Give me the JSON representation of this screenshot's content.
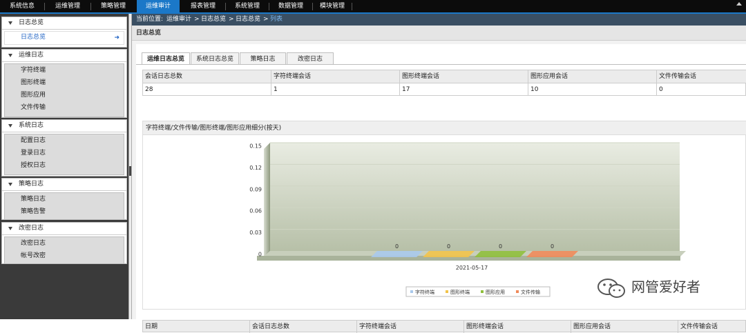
{
  "topnav": {
    "items": [
      "系统信息",
      "运维管理",
      "策略管理",
      "运维审计",
      "报表管理",
      "系统管理",
      "数据管理",
      "模块管理"
    ],
    "active_index": 3
  },
  "sidebar": {
    "groups": [
      {
        "title": "日志总览",
        "items": [
          "日志总览"
        ],
        "selected": "日志总览"
      },
      {
        "title": "运维日志",
        "items": [
          "字符终端",
          "图形终端",
          "图形应用",
          "文件传输"
        ]
      },
      {
        "title": "系统日志",
        "items": [
          "配置日志",
          "登录日志",
          "授权日志"
        ]
      },
      {
        "title": "策略日志",
        "items": [
          "策略日志",
          "策略告警"
        ]
      },
      {
        "title": "改密日志",
        "items": [
          "改密日志",
          "帐号改密"
        ]
      }
    ]
  },
  "breadcrumb": {
    "prefix": "当前位置:",
    "path": [
      "运维审计",
      "日志总览",
      "日志总览"
    ],
    "current": "列表",
    "separator": ">"
  },
  "page": {
    "title": "日志总览"
  },
  "tabs": {
    "items": [
      "运维日志总览",
      "系统日志总览",
      "策略日志",
      "改密日志"
    ],
    "active_index": 0
  },
  "summary": {
    "headers": [
      "会话日志总数",
      "字符终端会话",
      "图形终端会话",
      "图形应用会话",
      "文件传输会话"
    ],
    "values": [
      "28",
      "1",
      "17",
      "10",
      "0"
    ]
  },
  "chart": {
    "title": "字符终端/文件传输/图形终端/图形应用细分(按天)"
  },
  "chart_data": {
    "type": "bar",
    "categories": [
      "2021-05-17"
    ],
    "series": [
      {
        "name": "字符终端",
        "values": [
          0
        ],
        "color": "#a9c9ec"
      },
      {
        "name": "图形终端",
        "values": [
          0
        ],
        "color": "#f2c34a"
      },
      {
        "name": "图形应用",
        "values": [
          0
        ],
        "color": "#8fbf3c"
      },
      {
        "name": "文件传输",
        "values": [
          0
        ],
        "color": "#f08a5a"
      }
    ],
    "yticks": [
      "0.15",
      "0.12",
      "0.09",
      "0.06",
      "0.03",
      "0"
    ],
    "ylim": [
      0,
      0.15
    ],
    "grid": true,
    "legend": "bottom-center",
    "style": "3d"
  },
  "detail_table": {
    "headers": [
      "日期",
      "会话日志总数",
      "字符终端会话",
      "图形终端会话",
      "图形应用会话",
      "文件传输会话"
    ]
  },
  "watermark": {
    "text": "网管爱好者",
    "icon": "wechat-icon"
  }
}
